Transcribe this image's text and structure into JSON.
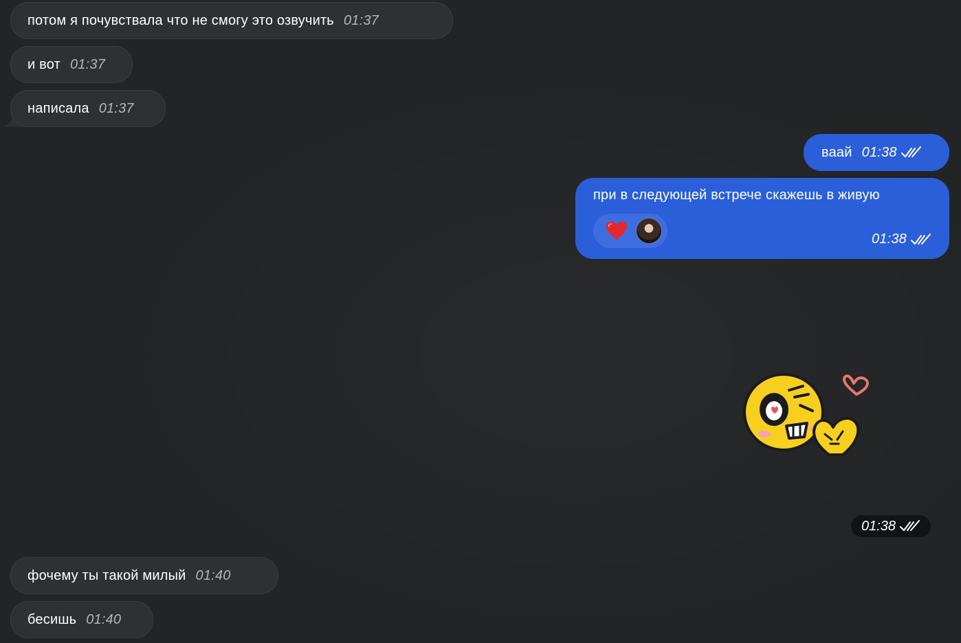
{
  "messages": [
    {
      "text": "потом я почувствала что не смогу это озвучить",
      "time": "01:37"
    },
    {
      "text": "и вот",
      "time": "01:37"
    },
    {
      "text": "написала",
      "time": "01:37"
    },
    {
      "text": "ваай",
      "time": "01:38"
    },
    {
      "text": "при в следующей встрече скажешь в живую",
      "time": "01:38",
      "reaction": "heart-icon"
    },
    {
      "time": "01:38",
      "sticker": "yellow-face-heart-hands-sticker"
    },
    {
      "text": "фочему ты такой милый",
      "time": "01:40"
    },
    {
      "text": "бесишь",
      "time": "01:40"
    }
  ],
  "colors": {
    "background": "#222426",
    "incoming_bubble": "#2e3033",
    "outgoing_bubble": "#2b5fd9",
    "incoming_time": "#b3b6bb"
  }
}
